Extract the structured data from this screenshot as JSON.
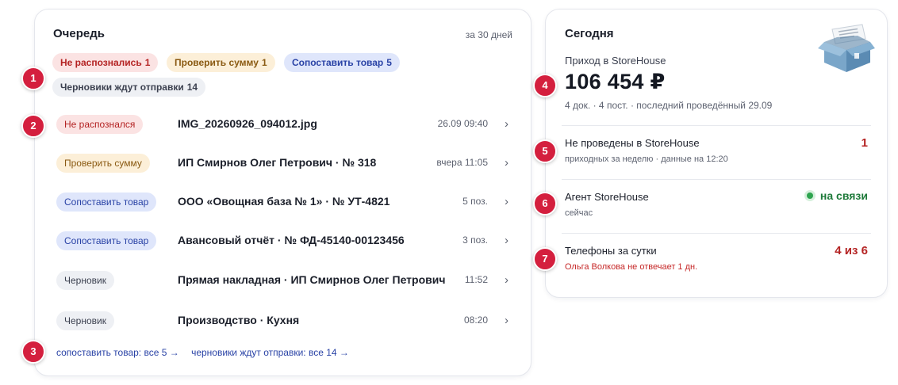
{
  "queue": {
    "title": "Очередь",
    "period": "за 30 дней",
    "summary": [
      {
        "label": "Не распознались",
        "count": "1",
        "color": "#fbe3e3"
      },
      {
        "label": "Проверить сумму",
        "count": "1",
        "color": "#fcefd8"
      },
      {
        "label": "Сопоставить товар",
        "count": "5",
        "color": "#dfe6fb"
      },
      {
        "label": "Черновики ждут отправки",
        "count": "14",
        "color": "#eef0f4"
      }
    ],
    "rows": [
      {
        "status": "Не распознался",
        "title": "IMG_20260926_094012.jpg",
        "meta": "26.09 09:40"
      },
      {
        "status": "Проверить сумму",
        "title": "ИП Смирнов Олег Петрович · № 318",
        "meta": "вчера 11:05"
      },
      {
        "status": "Сопоставить товар",
        "title": "ООО «Овощная база № 1» · № УТ-4821",
        "meta": "5 поз."
      },
      {
        "status": "Сопоставить товар",
        "title": "Авансовый отчёт · № ФД-45140-00123456",
        "meta": "3 поз."
      },
      {
        "status": "Черновик",
        "title": "Прямая накладная · ИП Смирнов Олег Петрович",
        "meta": "11:52"
      },
      {
        "status": "Черновик",
        "title": "Производство · Кухня",
        "meta": "08:20"
      }
    ],
    "chevron_icon": "chevron-right-icon",
    "links": [
      "сопоставить товар: все 5 →",
      "черновики ждут отправки: все 14 →"
    ]
  },
  "today": {
    "title": "Сегодня",
    "illustration": "open-box-with-document-icon",
    "income_label": "Приход в StoreHouse",
    "income_amount": "106 454 ₽",
    "income_sub": "4 док. · 4 пост. · последний проведённый 29.09",
    "not_posted": {
      "label": "Не проведены в StoreHouse",
      "sub": "приходных за неделю · данные на 12:20",
      "value": "1"
    },
    "agent": {
      "label": "Агент StoreHouse",
      "sub": "сейчас",
      "status": "на связи"
    },
    "phones": {
      "label": "Телефоны за сутки",
      "sub": "Ольга Волкова не отвечает 1 дн.",
      "value": "4 из 6"
    }
  },
  "markers": [
    "1",
    "2",
    "3",
    "4",
    "5",
    "6",
    "7"
  ],
  "colors": {
    "accent": "#2a43a6",
    "marker": "#d41f3e",
    "online": "#2ea44f",
    "danger": "#b42323"
  }
}
